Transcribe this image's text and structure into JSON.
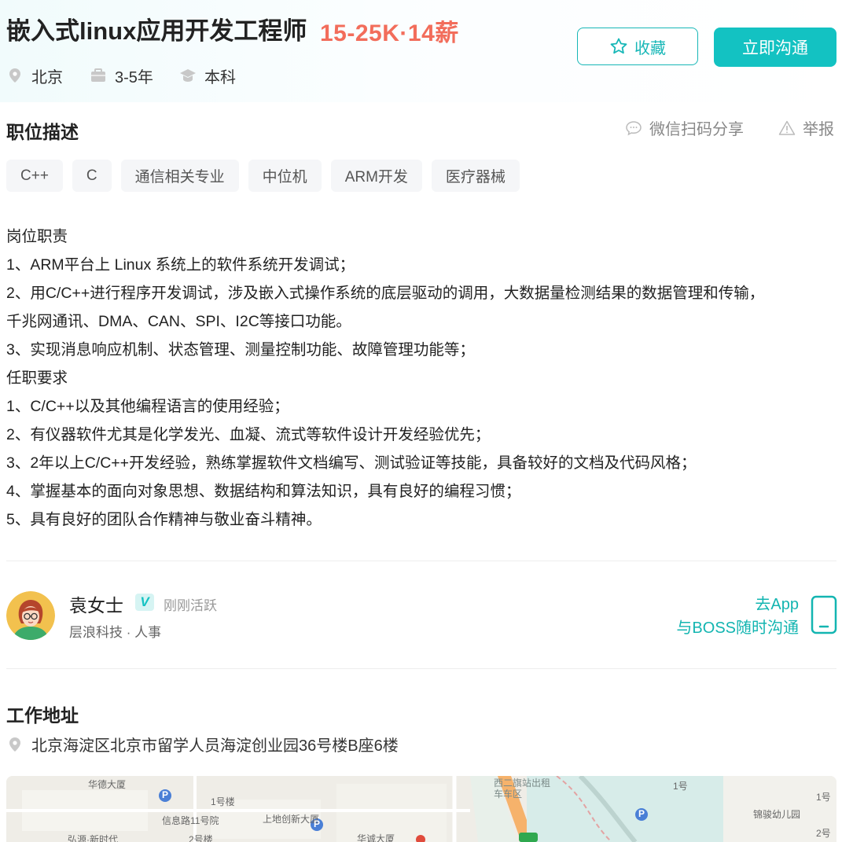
{
  "header": {
    "title": "嵌入式linux应用开发工程师",
    "salary": "15-25K·14薪",
    "city": "北京",
    "experience": "3-5年",
    "education": "本科",
    "collect_label": "收藏",
    "chat_label": "立即沟通"
  },
  "description": {
    "section_title": "职位描述",
    "share_label": "微信扫码分享",
    "report_label": "举报",
    "tags": [
      "C++",
      "C",
      "通信相关专业",
      "中位机",
      "ARM开发",
      "医疗器械"
    ],
    "lines": [
      "岗位职责",
      "1、ARM平台上 Linux 系统上的软件系统开发调试；",
      "2、用C/C++进行程序开发调试，涉及嵌入式操作系统的底层驱动的调用，大数据量检测结果的数据管理和传输，",
      "千兆网通讯、DMA、CAN、SPI、I2C等接口功能。",
      "3、实现消息响应机制、状态管理、测量控制功能、故障管理功能等；",
      "任职要求",
      "1、C/C++以及其他编程语言的使用经验；",
      "2、有仪器软件尤其是化学发光、血凝、流式等软件设计开发经验优先；",
      "3、2年以上C/C++开发经验，熟练掌握软件文档编写、测试验证等技能，具备较好的文档及代码风格；",
      "4、掌握基本的面向对象思想、数据结构和算法知识，具有良好的编程习惯；",
      "5、具有良好的团队合作精神与敬业奋斗精神。"
    ]
  },
  "boss": {
    "name": "袁女士",
    "badge": "V",
    "status": "刚刚活跃",
    "company_role": "层浪科技 · 人事",
    "app_line1": "去App",
    "app_line2": "与BOSS随时沟通"
  },
  "address": {
    "section_title": "工作地址",
    "text": "北京海淀区北京市留学人员海淀创业园36号楼B座6楼"
  },
  "map": {
    "labels": [
      "华德大厦",
      "1号楼",
      "信息路11号院",
      "上地创新大厦",
      "华诚大厦",
      "弘源·新时代",
      "2号楼",
      "西二旗站出租车车区",
      "1号",
      "锦骏幼儿园",
      "1号",
      "2号"
    ],
    "poi_markers": [
      "P",
      "P",
      "P"
    ]
  },
  "colors": {
    "accent": "#13c2c2",
    "salary": "#f26d5b"
  }
}
